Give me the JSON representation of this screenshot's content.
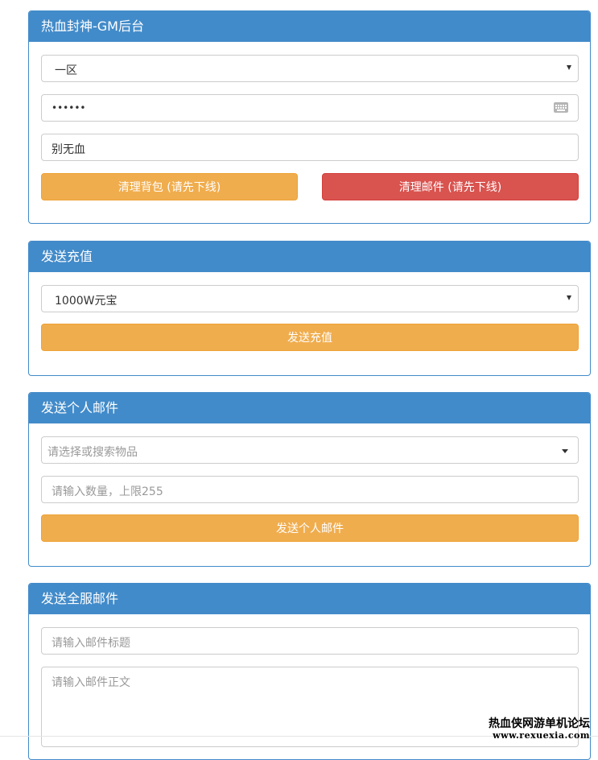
{
  "panel_gm": {
    "title": "热血封神-GM后台",
    "server_select": "一区",
    "password_value": "••••••",
    "character_name": "别无血",
    "clear_bag_button": "清理背包 (请先下线)",
    "clear_mail_button": "清理邮件 (请先下线)"
  },
  "panel_recharge": {
    "title": "发送充值",
    "amount_select": "1000W元宝",
    "send_button": "发送充值"
  },
  "panel_personal_mail": {
    "title": "发送个人邮件",
    "item_select_placeholder": "请选择或搜索物品",
    "quantity_placeholder": "请输入数量，上限255",
    "send_button": "发送个人邮件"
  },
  "panel_server_mail": {
    "title": "发送全服邮件",
    "subject_placeholder": "请输入邮件标题",
    "body_placeholder": "请输入邮件正文"
  },
  "watermark": {
    "line1": "热血侠网游单机论坛",
    "line2": "www.rexuexia.com"
  },
  "colors": {
    "primary": "#428bca",
    "warning": "#f0ad4e",
    "danger": "#d9534f"
  },
  "icons": [
    "keyboard-icon",
    "caret-down-icon"
  ]
}
